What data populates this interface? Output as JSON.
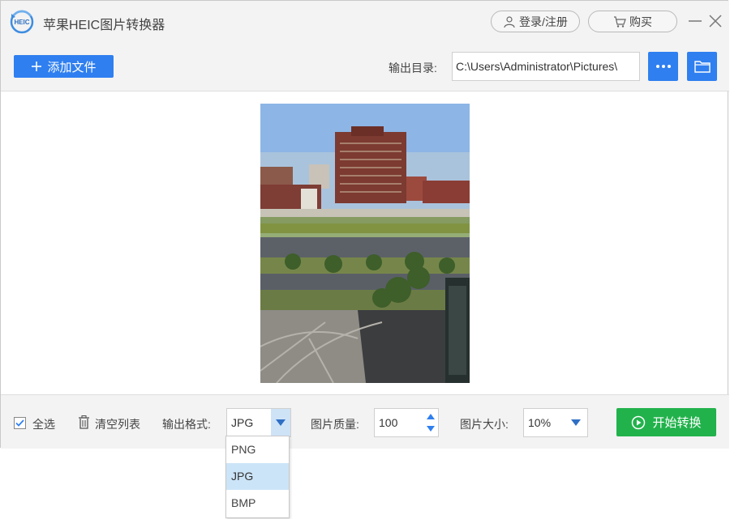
{
  "app": {
    "title": "苹果HEIC图片转换器",
    "logo_text": "HEIC"
  },
  "header": {
    "login_label": "登录/注册",
    "buy_label": "购买"
  },
  "toolbar": {
    "add_file_label": "添加文件",
    "output_dir_label": "输出目录:",
    "output_dir_value": "C:\\Users\\Administrator\\Pictures\\"
  },
  "bottom": {
    "select_all_label": "全选",
    "clear_list_label": "清空列表",
    "format_label": "输出格式:",
    "format_value": "JPG",
    "quality_label": "图片质量:",
    "quality_value": "100",
    "size_label": "图片大小:",
    "size_value": "10%",
    "start_label": "开始转换"
  },
  "format_options": [
    {
      "label": "PNG"
    },
    {
      "label": "JPG"
    },
    {
      "label": "BMP"
    }
  ],
  "colors": {
    "accent": "#2f7ff0",
    "start": "#22b24c",
    "selected_option": "#cce4f7"
  }
}
